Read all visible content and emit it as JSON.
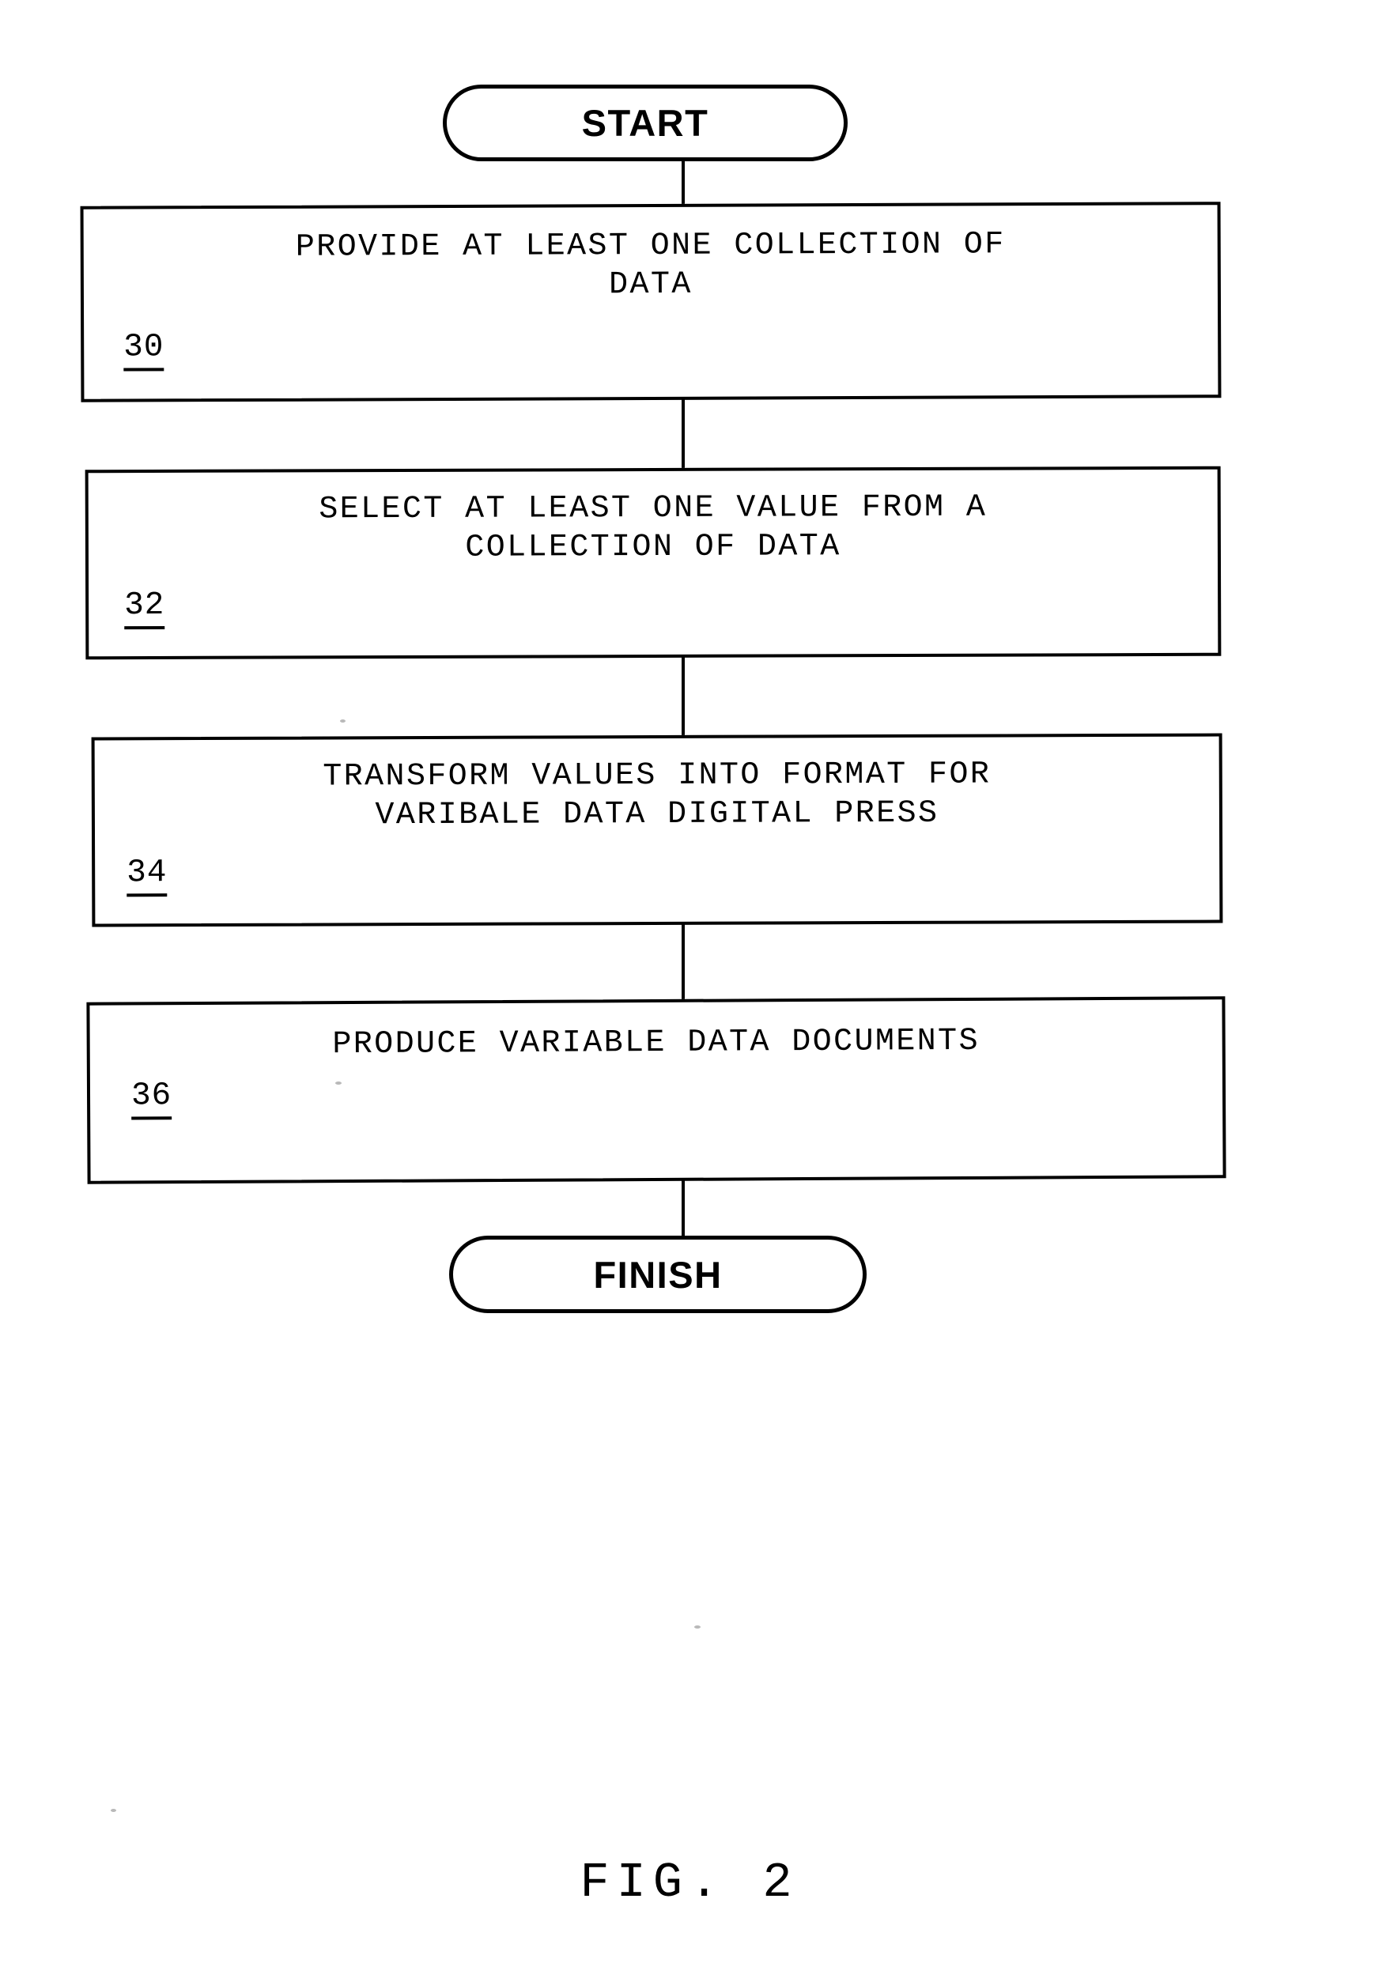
{
  "figure": {
    "caption": "FIG.  2"
  },
  "flowchart": {
    "start": {
      "label": "START",
      "shape": "stadium"
    },
    "finish": {
      "label": "FINISH",
      "shape": "stadium"
    },
    "steps": [
      {
        "ref": "30",
        "text": "PROVIDE AT LEAST ONE COLLECTION OF\nDATA"
      },
      {
        "ref": "32",
        "text": "SELECT AT LEAST ONE VALUE FROM A\nCOLLECTION OF DATA"
      },
      {
        "ref": "34",
        "text": "TRANSFORM VALUES INTO FORMAT FOR\nVARIBALE DATA DIGITAL PRESS"
      },
      {
        "ref": "36",
        "text": "PRODUCE VARIABLE DATA DOCUMENTS"
      }
    ]
  },
  "colors": {
    "ink": "#000000",
    "paper": "#ffffff"
  }
}
